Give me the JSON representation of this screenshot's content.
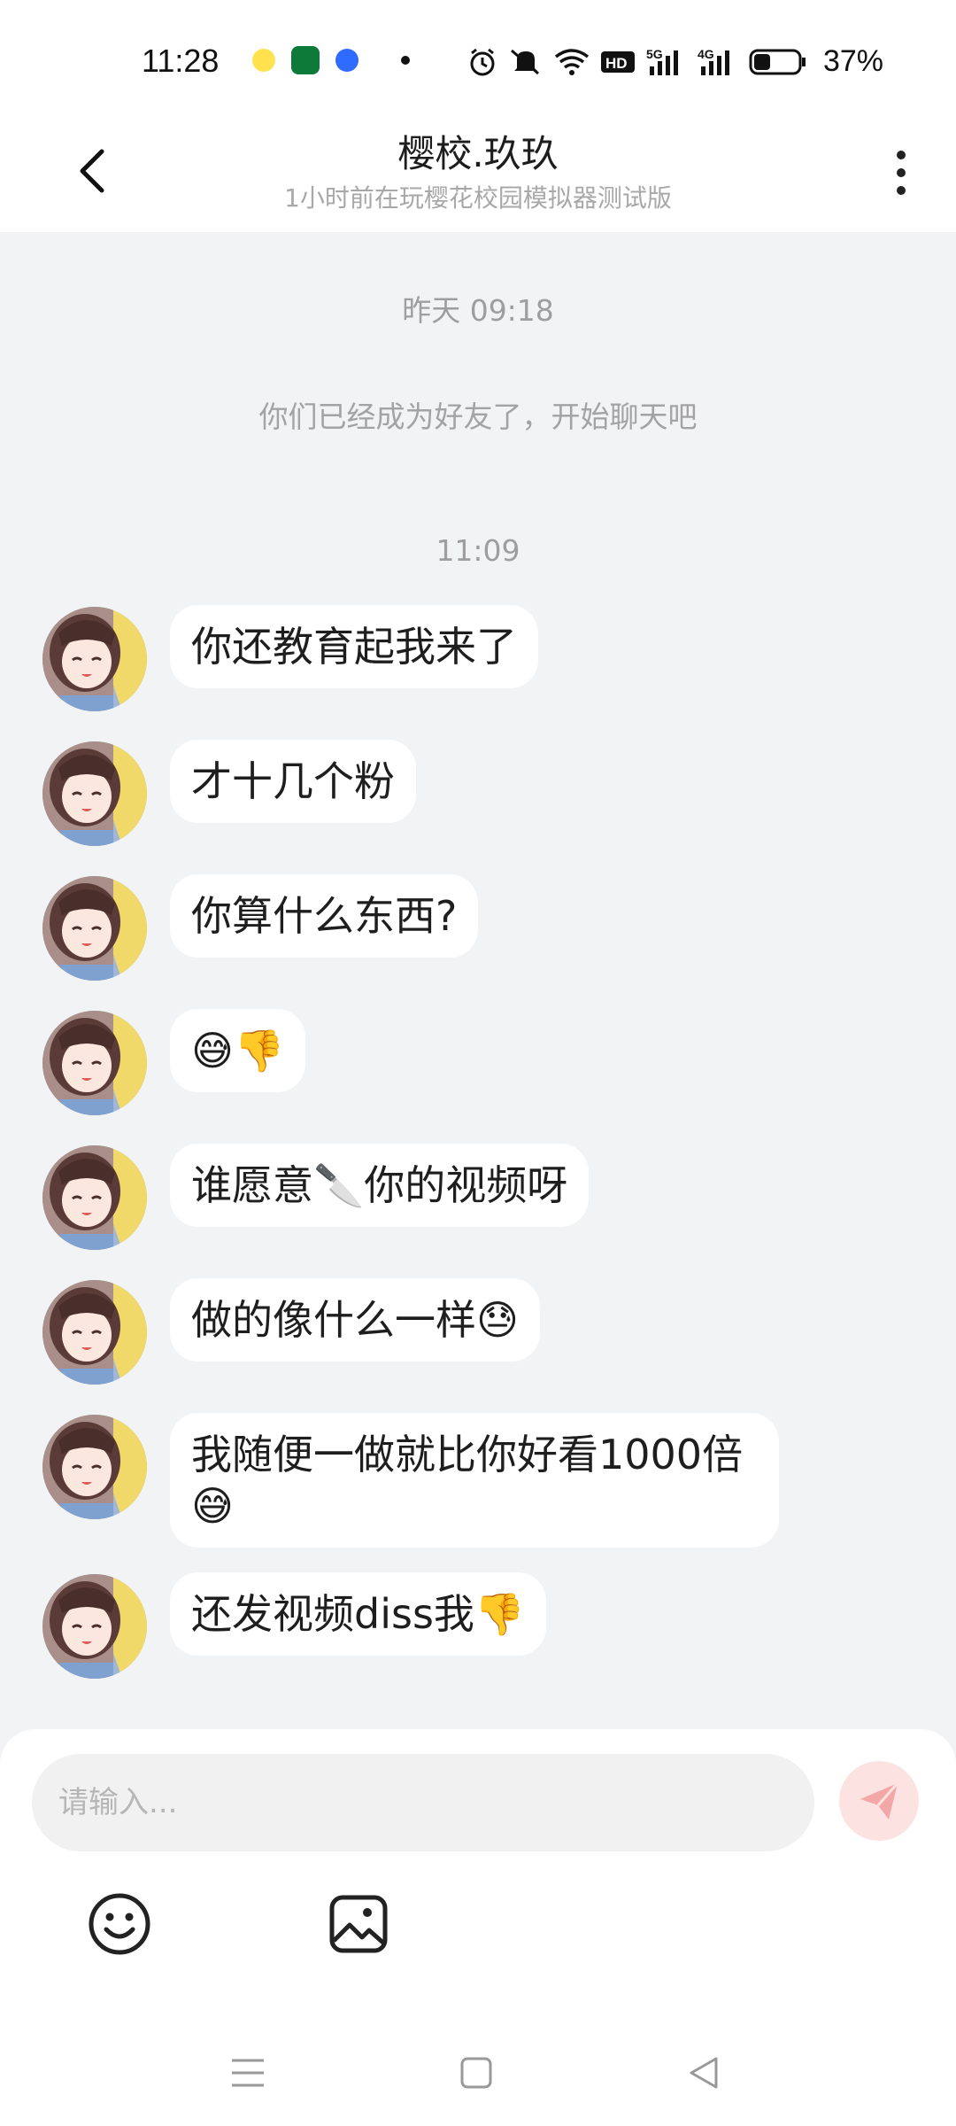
{
  "status_bar": {
    "time": "11:28",
    "battery_percent": "37%",
    "battery_level": 0.37,
    "icons": [
      "notification-app-icon",
      "oppo-app-icon",
      "blue-app-icon",
      "dot-icon",
      "alarm-icon",
      "mute-icon",
      "wifi-icon",
      "hd-icon",
      "5g-signal-icon",
      "4g-signal-icon",
      "battery-icon"
    ]
  },
  "header": {
    "title": "樱校.玖玖",
    "subtitle": "1小时前在玩樱花校园模拟器测试版"
  },
  "chat": {
    "timestamp1": "昨天 09:18",
    "system_message": "你们已经成为好友了，开始聊天吧",
    "timestamp2": "11:09",
    "messages": [
      {
        "text": "你还教育起我来了"
      },
      {
        "text": "才十几个粉"
      },
      {
        "text": "你算什么东西?"
      },
      {
        "text": "😅👎"
      },
      {
        "text": "谁愿意🔪你的视频呀"
      },
      {
        "text": "做的像什么一样😓"
      },
      {
        "text": "我随便一做就比你好看1000倍😅"
      },
      {
        "text": "还发视频diss我👎"
      }
    ]
  },
  "input": {
    "placeholder": "请输入..."
  },
  "colors": {
    "background": "#f2f3f5",
    "bubble": "#ffffff",
    "send_button": "#fde2e2",
    "send_icon": "#f4a7a7"
  }
}
